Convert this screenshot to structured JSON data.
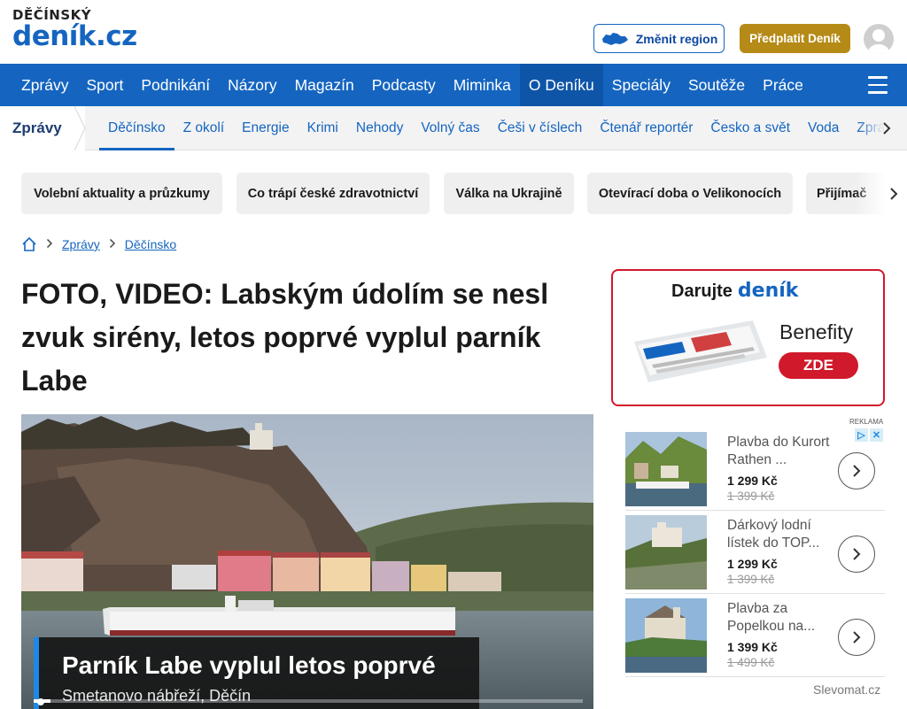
{
  "header": {
    "logo_small": "DĚČÍNSKÝ",
    "logo_big": "deník.cz",
    "region_button": "Změnit region",
    "subscribe_button": "Předplatit Deník"
  },
  "main_nav": {
    "items": [
      "Zprávy",
      "Sport",
      "Podnikání",
      "Názory",
      "Magazín",
      "Podcasty",
      "Miminka",
      "O Deníku",
      "Speciály",
      "Soutěže",
      "Práce"
    ],
    "active": "O Deníku"
  },
  "sub_nav": {
    "title": "Zprávy",
    "items": [
      "Děčínsko",
      "Z okolí",
      "Energie",
      "Krimi",
      "Nehody",
      "Volný čas",
      "Češi v číslech",
      "Čtenář reportér",
      "Česko a svět",
      "Voda",
      "Zprá"
    ],
    "active": "Děčínsko"
  },
  "topics": [
    "Volební aktuality a průzkumy",
    "Co trápí české zdravotnictví",
    "Válka na Ukrajině",
    "Otevírací doba o Velikonocích",
    "Přijímač"
  ],
  "breadcrumb": {
    "items": [
      "Zprávy",
      "Děčínsko"
    ]
  },
  "article": {
    "headline": "FOTO, VIDEO: Labským údolím se nesl zvuk sirény, letos poprvé vyplul parník Labe"
  },
  "video": {
    "caption_title": "Parník Labe vyplul letos poprvé",
    "caption_sub": "Smetanovo nábřeží, Děčín",
    "progress": 0.03
  },
  "promo": {
    "darujte": "Darujte",
    "denik": "deník",
    "benefity": "Benefity",
    "cta": "ZDE"
  },
  "ad": {
    "reklama": "REKLAMA",
    "offers": [
      {
        "title": "Plavba do Kurort Rathen ...",
        "price": "1 299 Kč",
        "old_price": "1 399 Kč"
      },
      {
        "title": "Dárkový lodní lístek do TOP...",
        "price": "1 299 Kč",
        "old_price": "1 399 Kč"
      },
      {
        "title": "Plavba za Popelkou na...",
        "price": "1 399 Kč",
        "old_price": "1 499 Kč"
      }
    ],
    "source": "Slevomat.cz"
  },
  "colors": {
    "brand_blue": "#1565c0",
    "gold": "#b58a16",
    "promo_red": "#d0192b"
  }
}
